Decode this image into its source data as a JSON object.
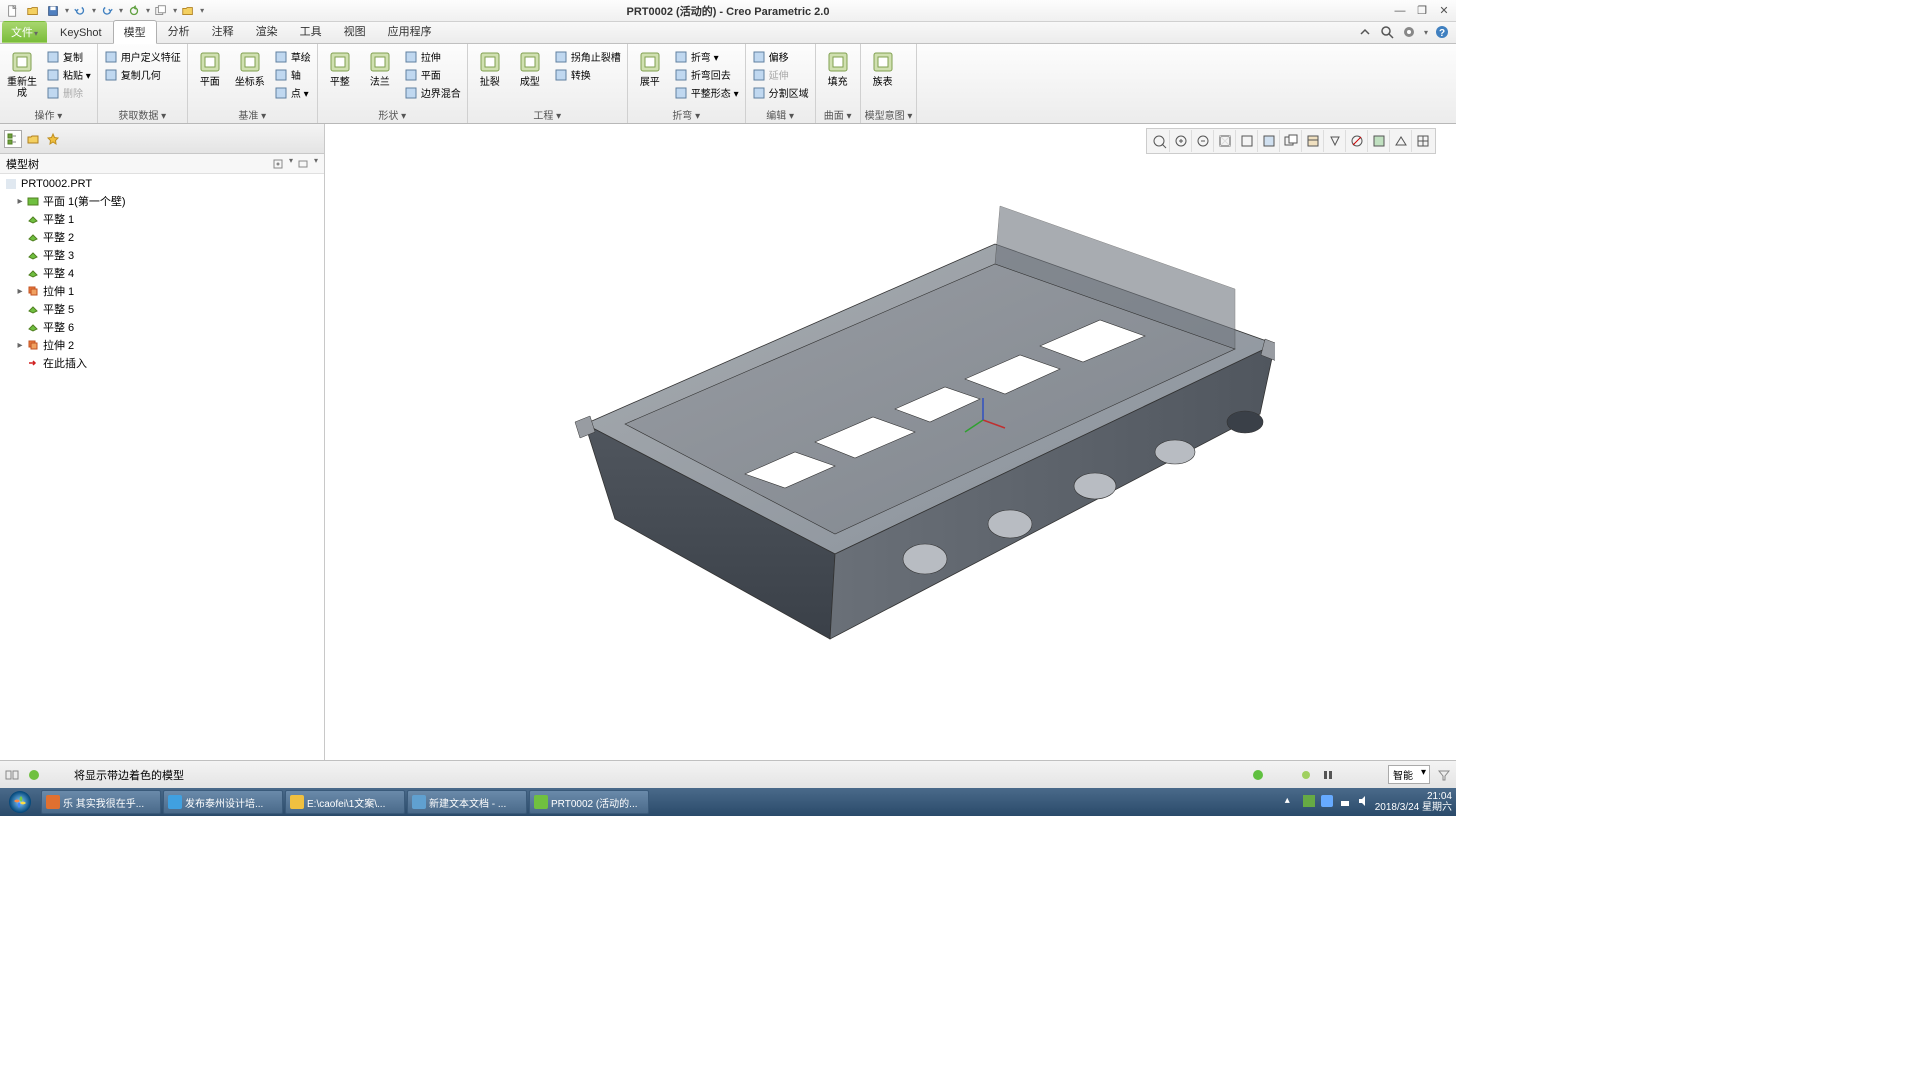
{
  "title": "PRT0002 (活动的) - Creo Parametric 2.0",
  "qat": [
    "new",
    "open",
    "save",
    "undo",
    "redo",
    "regen",
    "windows",
    "close",
    "folder"
  ],
  "ribbon": {
    "tabs": [
      "文件",
      "KeyShot",
      "模型",
      "分析",
      "注释",
      "渲染",
      "工具",
      "视图",
      "应用程序"
    ],
    "active_index": 2,
    "right_icons": [
      "collapse",
      "search",
      "settings",
      "help"
    ],
    "groups": [
      {
        "label": "操作 ▾",
        "big": [
          {
            "lbl": "重新生成"
          }
        ],
        "small": [
          {
            "lbl": "复制"
          },
          {
            "lbl": "粘贴 ▾"
          },
          {
            "lbl": "删除",
            "disabled": true
          }
        ]
      },
      {
        "label": "获取数据 ▾",
        "small": [
          {
            "lbl": "用户定义特征"
          },
          {
            "lbl": "复制几何"
          }
        ]
      },
      {
        "label": "基准 ▾",
        "big": [
          {
            "lbl": "平面"
          },
          {
            "lbl": "坐标系"
          }
        ],
        "small": [
          {
            "lbl": "草绘"
          },
          {
            "lbl": "轴"
          },
          {
            "lbl": "点 ▾"
          }
        ]
      },
      {
        "label": "形状 ▾",
        "big": [
          {
            "lbl": "平整"
          },
          {
            "lbl": "法兰"
          }
        ],
        "small": [
          {
            "lbl": "拉伸"
          },
          {
            "lbl": "平面"
          },
          {
            "lbl": "边界混合"
          }
        ]
      },
      {
        "label": "工程 ▾",
        "big": [
          {
            "lbl": "扯裂"
          },
          {
            "lbl": "成型"
          }
        ],
        "small": [
          {
            "lbl": "拐角止裂槽"
          },
          {
            "lbl": "转换"
          }
        ]
      },
      {
        "label": "折弯 ▾",
        "big": [
          {
            "lbl": "展平"
          }
        ],
        "small": [
          {
            "lbl": "折弯 ▾"
          },
          {
            "lbl": "折弯回去"
          },
          {
            "lbl": "平整形态 ▾"
          }
        ]
      },
      {
        "label": "编辑 ▾",
        "small": [
          {
            "lbl": "偏移"
          },
          {
            "lbl": "延伸",
            "disabled": true
          },
          {
            "lbl": "分割区域"
          }
        ]
      },
      {
        "label": "曲面 ▾",
        "big": [
          {
            "lbl": "填充"
          }
        ]
      },
      {
        "label": "模型意图 ▾",
        "big": [
          {
            "lbl": "族表"
          }
        ]
      }
    ]
  },
  "modeltree": {
    "title": "模型树",
    "root": "PRT0002.PRT",
    "items": [
      {
        "lbl": "平面 1(第一个壁)",
        "ico": "wall",
        "exp": "▸"
      },
      {
        "lbl": "平整 1",
        "ico": "flat"
      },
      {
        "lbl": "平整 2",
        "ico": "flat"
      },
      {
        "lbl": "平整 3",
        "ico": "flat"
      },
      {
        "lbl": "平整 4",
        "ico": "flat"
      },
      {
        "lbl": "拉伸 1",
        "ico": "extrude",
        "exp": "▸"
      },
      {
        "lbl": "平整 5",
        "ico": "flat"
      },
      {
        "lbl": "平整 6",
        "ico": "flat"
      },
      {
        "lbl": "拉伸 2",
        "ico": "extrude",
        "exp": "▸"
      },
      {
        "lbl": "在此插入",
        "ico": "insert"
      }
    ]
  },
  "vp_toolbar": [
    "zoom-fit",
    "zoom-in",
    "zoom-out",
    "repaint",
    "box",
    "dropdown",
    "saved-view",
    "layers",
    "annotations",
    "noshow",
    "appearance",
    "perspective",
    "grid"
  ],
  "status": {
    "msg": "将显示带边着色的模型",
    "selector": "智能"
  },
  "taskbar": {
    "items": [
      {
        "lbl": "乐 其实我很在乎...",
        "color": "#e07030"
      },
      {
        "lbl": "发布泰州设计培...",
        "color": "#40a0e0"
      },
      {
        "lbl": "E:\\caofei\\1文案\\...",
        "color": "#f0c040"
      },
      {
        "lbl": "新建文本文档 - ...",
        "color": "#60a0d0"
      },
      {
        "lbl": "PRT0002 (活动的...",
        "color": "#70c040"
      }
    ],
    "clock": {
      "time": "21:04",
      "date": "2018/3/24 星期六"
    }
  }
}
